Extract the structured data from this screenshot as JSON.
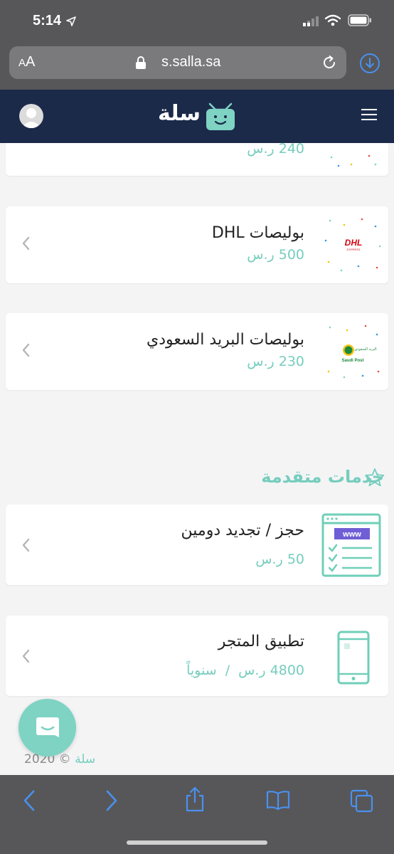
{
  "status_bar": {
    "time": "5:14"
  },
  "browser": {
    "aa_large": "A",
    "aa_small": "A",
    "url": "s.salla.sa"
  },
  "header": {
    "logo_text": "سلة"
  },
  "cards": [
    {
      "title": "",
      "price": "240 ر.س"
    },
    {
      "title": "بوليصات DHL",
      "price": "500 ر.س",
      "logo_text": "DHL"
    },
    {
      "title": "بوليصات البريد السعودي",
      "price": "230 ر.س",
      "logo_text_ar": "البريد السعودي",
      "logo_text_en": "Saudi Post"
    },
    {
      "title": "حجز / تجديد دومين",
      "price": "50 ر.س",
      "icon_text": "www"
    },
    {
      "title": "تطبيق المتجر",
      "price": "4800 ر.س  /  سنوياً"
    }
  ],
  "section": {
    "title": "خدمات متقدمة"
  },
  "footer": {
    "brand": "سلة",
    "copyright": "© 2020"
  },
  "colors": {
    "accent": "#76cdbe",
    "header_bg": "#1c2a4a",
    "browser_chrome": "#575759",
    "ios_blue": "#4a90f0"
  }
}
